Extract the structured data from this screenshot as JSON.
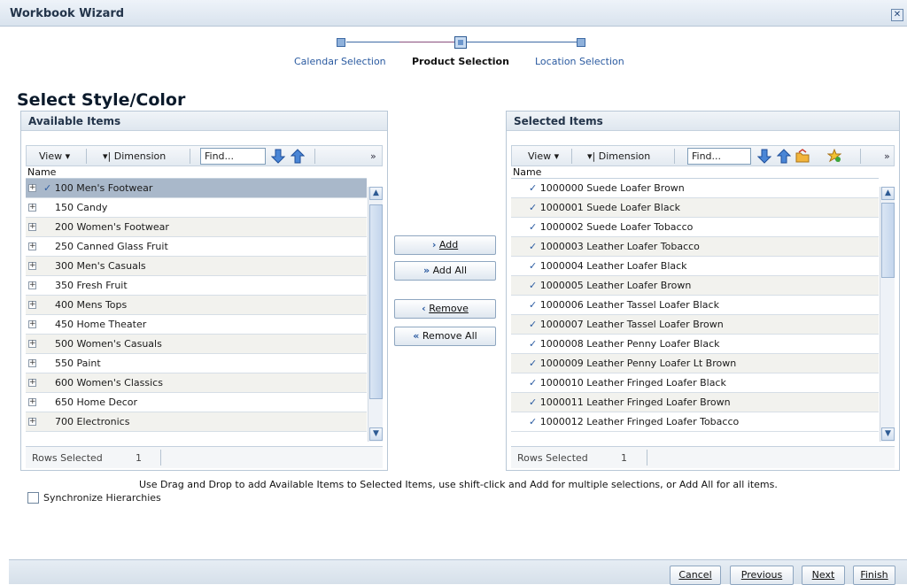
{
  "window": {
    "title": "Workbook Wizard",
    "close_glyph": "✕"
  },
  "train": {
    "steps": [
      {
        "label": "Calendar Selection",
        "current": false
      },
      {
        "label": "Product Selection",
        "current": true
      },
      {
        "label": "Location Selection",
        "current": false
      }
    ]
  },
  "page_title": "Select Style/Color",
  "available": {
    "header": "Available Items",
    "toolbar": {
      "view": "View",
      "dimension": "Dimension",
      "find_placeholder": "Find...",
      "overflow": "»"
    },
    "column": "Name",
    "rows": [
      {
        "label": "100 Men's Footwear",
        "checked": true,
        "selected": true
      },
      {
        "label": "150 Candy",
        "checked": false
      },
      {
        "label": "200 Women's Footwear",
        "checked": false
      },
      {
        "label": "250 Canned Glass Fruit",
        "checked": false
      },
      {
        "label": "300 Men's Casuals",
        "checked": false
      },
      {
        "label": "350 Fresh Fruit",
        "checked": false
      },
      {
        "label": "400 Mens Tops",
        "checked": false
      },
      {
        "label": "450 Home Theater",
        "checked": false
      },
      {
        "label": "500 Women's Casuals",
        "checked": false
      },
      {
        "label": "550 Paint",
        "checked": false
      },
      {
        "label": "600 Women's Classics",
        "checked": false
      },
      {
        "label": "650 Home Decor",
        "checked": false
      },
      {
        "label": "700 Electronics",
        "checked": false
      }
    ],
    "status_label": "Rows Selected",
    "status_value": "1"
  },
  "selected": {
    "header": "Selected Items",
    "toolbar": {
      "view": "View",
      "dimension": "Dimension",
      "find_placeholder": "Find...",
      "overflow": "»"
    },
    "column": "Name",
    "rows": [
      "1000000 Suede Loafer Brown",
      "1000001 Suede Loafer Black",
      "1000002 Suede Loafer Tobacco",
      "1000003 Leather Loafer Tobacco",
      "1000004 Leather Loafer Black",
      "1000005 Leather Loafer Brown",
      "1000006 Leather Tassel Loafer Black",
      "1000007 Leather Tassel Loafer Brown",
      "1000008 Leather Penny Loafer Black",
      "1000009 Leather Penny Loafer Lt Brown",
      "1000010 Leather Fringed Loafer Black",
      "1000011 Leather Fringed Loafer Brown",
      "1000012 Leather Fringed Loafer Tobacco"
    ],
    "status_label": "Rows Selected",
    "status_value": "1"
  },
  "shuttle": {
    "add": "Add",
    "add_all": "Add All",
    "remove": "Remove",
    "remove_all": "Remove All"
  },
  "hint": "Use Drag and Drop to add Available Items to Selected Items, use shift-click and Add for multiple selections, or Add All for all items.",
  "sync_label": "Synchronize Hierarchies",
  "footer": {
    "cancel": "Cancel",
    "previous": "Previous",
    "next": "Next",
    "finish": "Finish"
  },
  "colors": {
    "accent": "#2a5aa0",
    "selected_row": "#a9b8ca",
    "train_line": "#8a4f7d"
  }
}
